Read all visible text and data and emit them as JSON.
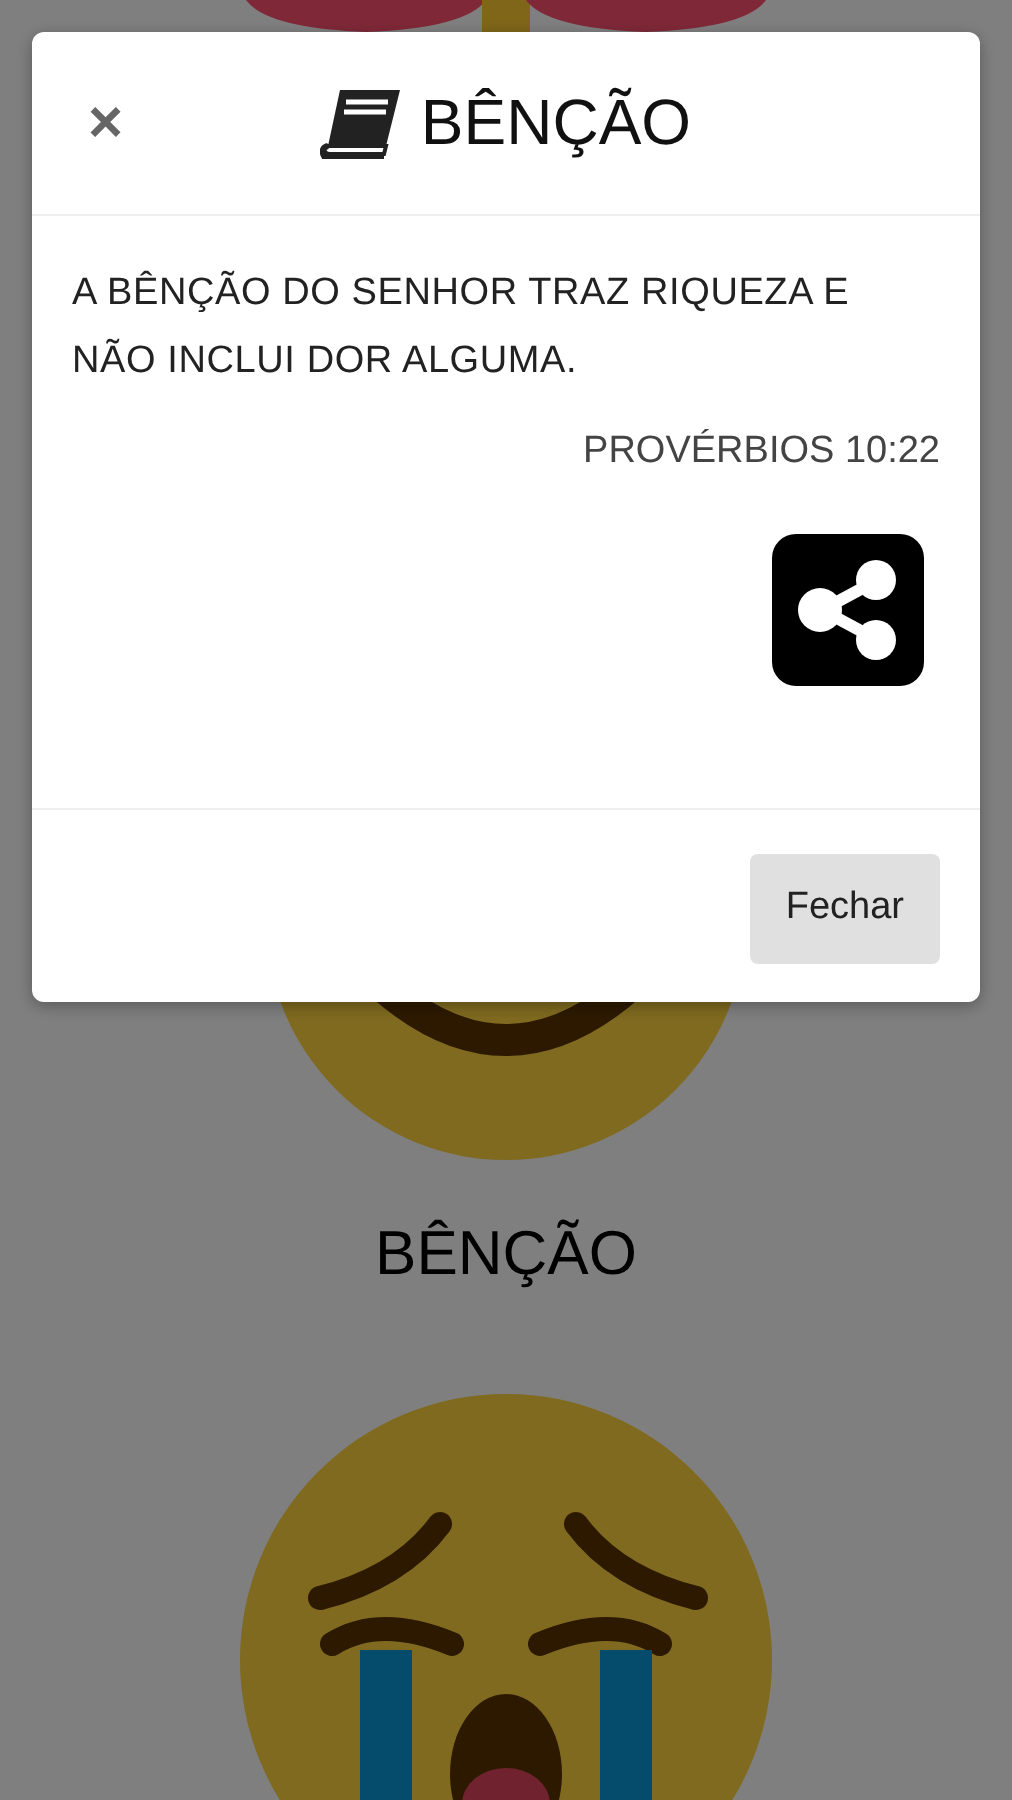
{
  "background": {
    "cards": [
      {
        "kind": "red"
      },
      {
        "kind": "smile",
        "label": "BÊNÇÃO"
      },
      {
        "kind": "crying"
      }
    ]
  },
  "modal": {
    "close": "×",
    "title": "BÊNÇÃO",
    "verse": "A BÊNÇÃO DO SENHOR TRAZ RIQUEZA E NÃO INCLUI DOR ALGUMA.",
    "reference": "PROVÉRBIOS 10:22",
    "buttons": [
      "Fechar"
    ]
  }
}
